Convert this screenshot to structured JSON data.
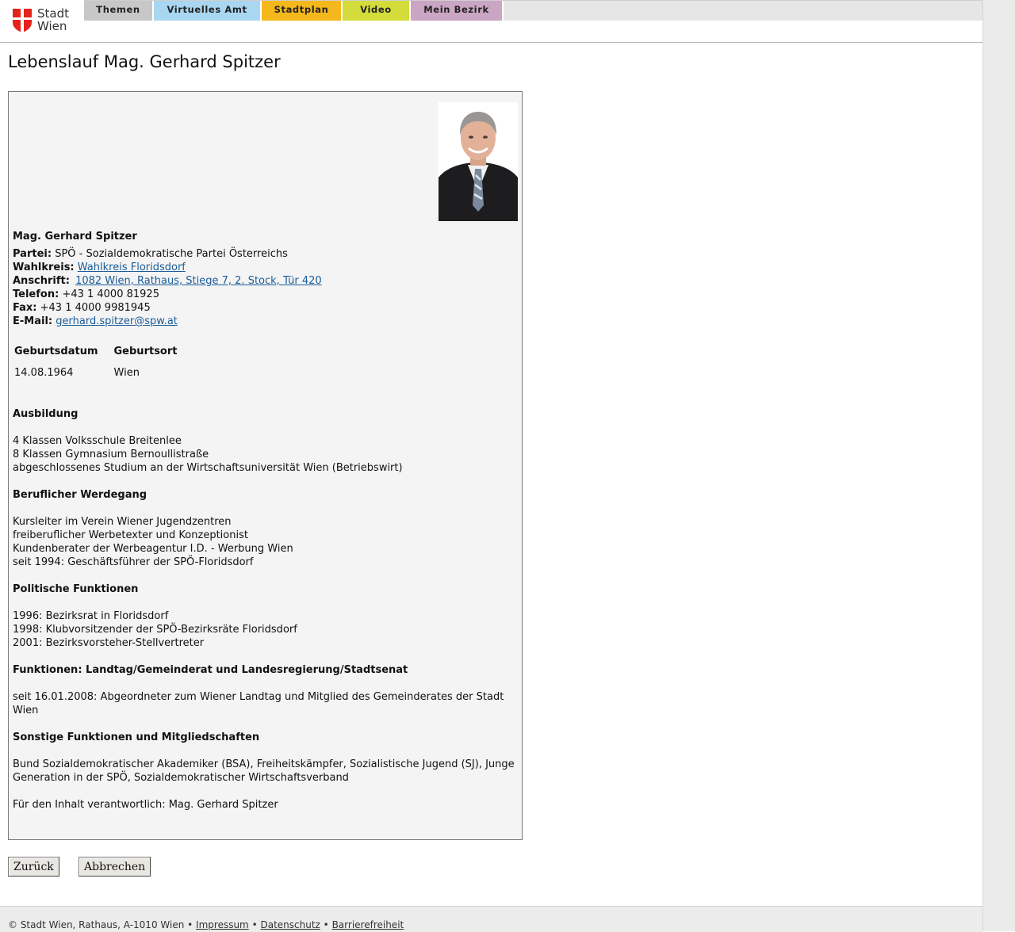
{
  "header": {
    "logo_text_line1": "Stadt",
    "logo_text_line2": "Wien",
    "nav": [
      {
        "label": "Themen"
      },
      {
        "label": "Virtuelles Amt"
      },
      {
        "label": "Stadtplan"
      },
      {
        "label": "Video"
      },
      {
        "label": "Mein Bezirk"
      }
    ]
  },
  "page_title": "Lebenslauf Mag. Gerhard Spitzer",
  "person": {
    "name": "Mag. Gerhard Spitzer",
    "partei_label": "Partei:",
    "partei": "SPÖ - Sozialdemokratische Partei Österreichs",
    "wahlkreis_label": "Wahlkreis:",
    "wahlkreis": "Wahlkreis Floridsdorf",
    "anschrift_label": "Anschrift:",
    "anschrift": "1082 Wien, Rathaus, Stiege 7, 2. Stock, Tür 420",
    "telefon_label": "Telefon:",
    "telefon": "+43 1 4000 81925",
    "fax_label": "Fax:",
    "fax": "+43 1 4000 9981945",
    "email_label": "E-Mail:",
    "email": "gerhard.spitzer@spw.at"
  },
  "birth": {
    "col1": "Geburtsdatum",
    "col2": "Geburtsort",
    "date": "14.08.1964",
    "place": "Wien"
  },
  "sections": {
    "ausbildung": {
      "title": "Ausbildung",
      "lines": [
        "4 Klassen Volksschule Breitenlee",
        "8 Klassen Gymnasium Bernoullistraße",
        "abgeschlossenes Studium an der Wirtschaftsuniversität Wien (Betriebswirt)"
      ]
    },
    "werdegang": {
      "title": "Beruflicher Werdegang",
      "lines": [
        "Kursleiter im Verein Wiener Jugendzentren",
        "freiberuflicher Werbetexter und Konzeptionist",
        "Kundenberater der Werbeagentur I.D. - Werbung Wien",
        "seit 1994: Geschäftsführer der SPÖ-Floridsdorf"
      ]
    },
    "politisch": {
      "title": "Politische Funktionen",
      "lines": [
        "1996: Bezirksrat in Floridsdorf",
        "1998: Klubvorsitzender der SPÖ-Bezirksräte Floridsdorf",
        "2001: Bezirksvorsteher-Stellvertreter"
      ]
    },
    "landtag": {
      "title": "Funktionen: Landtag/Gemeinderat und Landesregierung/Stadtsenat",
      "line1": "seit 16.01.2008: Abgeordneter zum Wiener Landtag und Mitglied des Gemeinderates der Stadt",
      "line2": "Wien"
    },
    "sonstige": {
      "title": "Sonstige Funktionen und Mitgliedschaften",
      "line1": "Bund Sozialdemokratischer Akademiker (BSA), Freiheitskämpfer, Sozialistische Jugend (SJ), Junge",
      "line2": "Generation in der SPÖ, Sozialdemokratischer Wirtschaftsverband"
    },
    "verantwortlich": "Für den Inhalt verantwortlich: Mag. Gerhard Spitzer"
  },
  "buttons": {
    "back": "Zurück",
    "cancel": "Abbrechen"
  },
  "footer": {
    "copyright": "© Stadt Wien, Rathaus, A-1010 Wien",
    "sep": "•",
    "impressum": "Impressum",
    "datenschutz": "Datenschutz",
    "barrierefreiheit": "Barrierefreiheit"
  },
  "colors": {
    "tab_themen": "#c7c7c7",
    "tab_amt": "#a9d6f0",
    "tab_stadtplan": "#f5b81c",
    "tab_video": "#d3dc3a",
    "tab_bezirk": "#cba5c4",
    "logo_red": "#e4241b"
  }
}
